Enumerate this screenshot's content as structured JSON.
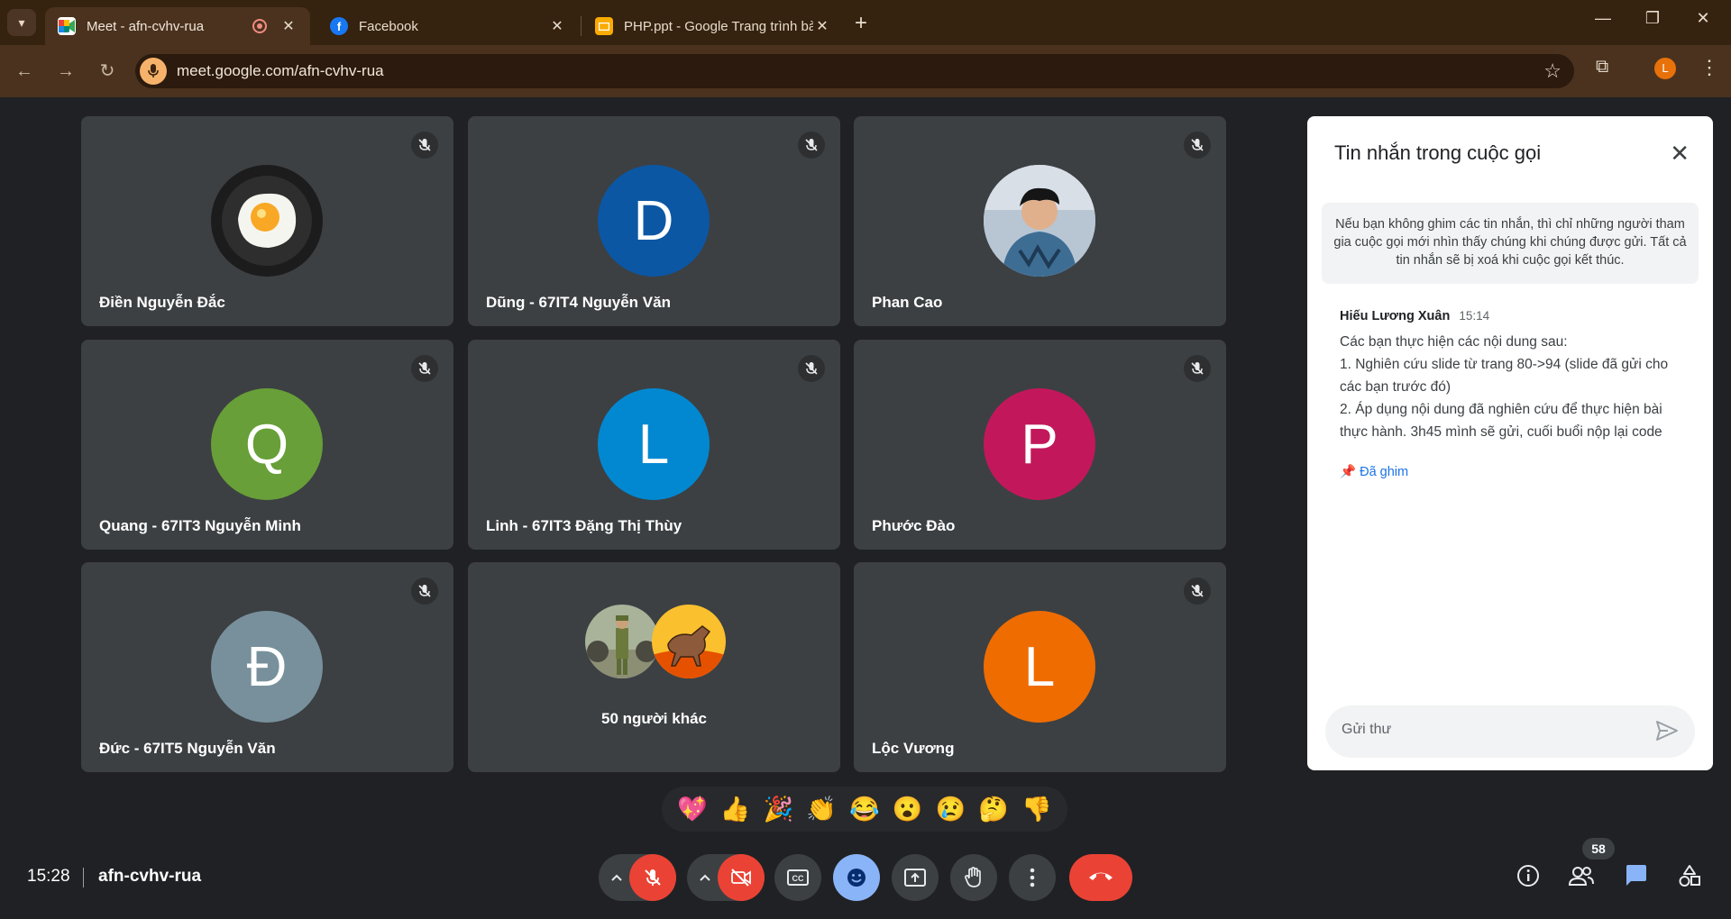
{
  "browser": {
    "tabs": [
      {
        "title": "Meet - afn-cvhv-rua"
      },
      {
        "title": "Facebook"
      },
      {
        "title": "PHP.ppt - Google Trang trình bày"
      }
    ],
    "url": "meet.google.com/afn-cvhv-rua",
    "profile_initial": "L"
  },
  "participants": [
    {
      "name": "Điền Nguyễn Đắc",
      "avatar": "fried-egg-photo"
    },
    {
      "name": "Dũng - 67IT4 Nguyễn Văn",
      "initial": "D",
      "color": "#0b57a4"
    },
    {
      "name": "Phan Cao",
      "avatar": "person-photo"
    },
    {
      "name": "Quang - 67IT3 Nguyễn Minh",
      "initial": "Q",
      "color": "#689f38"
    },
    {
      "name": "Linh - 67IT3 Đặng Thị Thùy",
      "initial": "L",
      "color": "#0288d1"
    },
    {
      "name": "Phước Đào",
      "initial": "P",
      "color": "#c2185b"
    },
    {
      "name": "Đức - 67IT5 Nguyễn Văn",
      "initial": "Đ",
      "color": "#78909c"
    },
    {
      "name": "Lộc Vương",
      "initial": "L",
      "color": "#ef6c00"
    }
  ],
  "others_tile": {
    "label": "50 người khác"
  },
  "chat": {
    "title": "Tin nhắn trong cuộc gọi",
    "notice": "Nếu bạn không ghim các tin nhắn, thì chỉ những người tham gia cuộc gọi mới nhìn thấy chúng khi chúng được gửi. Tất cả tin nhắn sẽ bị xoá khi cuộc gọi kết thúc.",
    "message": {
      "sender": "Hiếu Lương Xuân",
      "time": "15:14",
      "lines": [
        "Các bạn thực hiện các nội dung sau:",
        "1. Nghiên cứu slide từ trang 80->94 (slide đã gửi cho các bạn trước đó)",
        "2. Áp dụng nội dung đã nghiên cứu để thực hiện bài thực hành. 3h45 mình sẽ gửi, cuối buổi nộp lại code"
      ],
      "pinned_label": "Đã ghim"
    },
    "input_placeholder": "Gửi thư"
  },
  "reactions": [
    "💖",
    "👍",
    "🎉",
    "👏",
    "😂",
    "😮",
    "😢",
    "🤔",
    "👎"
  ],
  "bottom": {
    "time": "15:28",
    "meeting_code": "afn-cvhv-rua",
    "participant_count": "58"
  },
  "colors": {
    "accent_blue": "#8ab4f8",
    "hangup_red": "#ea4335",
    "tile_bg": "#3c4043"
  }
}
